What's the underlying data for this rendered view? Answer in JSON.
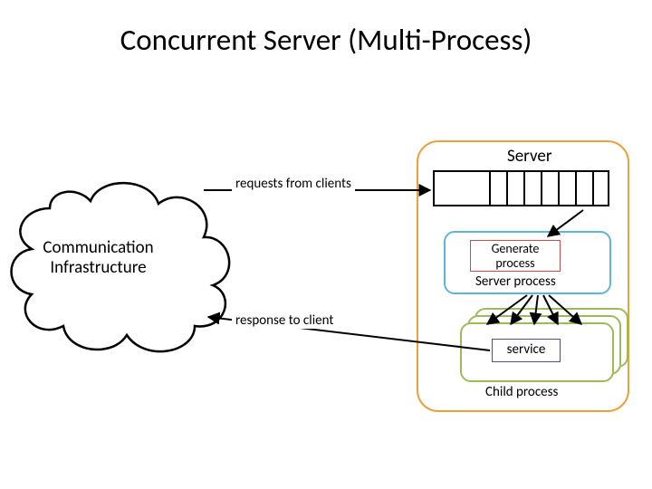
{
  "title": "Concurrent Server (Multi-Process)",
  "comm_infra": "Communication\nInfrastructure",
  "labels": {
    "server": "Server",
    "requests": "requests from clients",
    "response": "response to client",
    "server_process": "Server process",
    "child_process": "Child process",
    "service": "service",
    "generate_process": "Generate\nprocess"
  }
}
